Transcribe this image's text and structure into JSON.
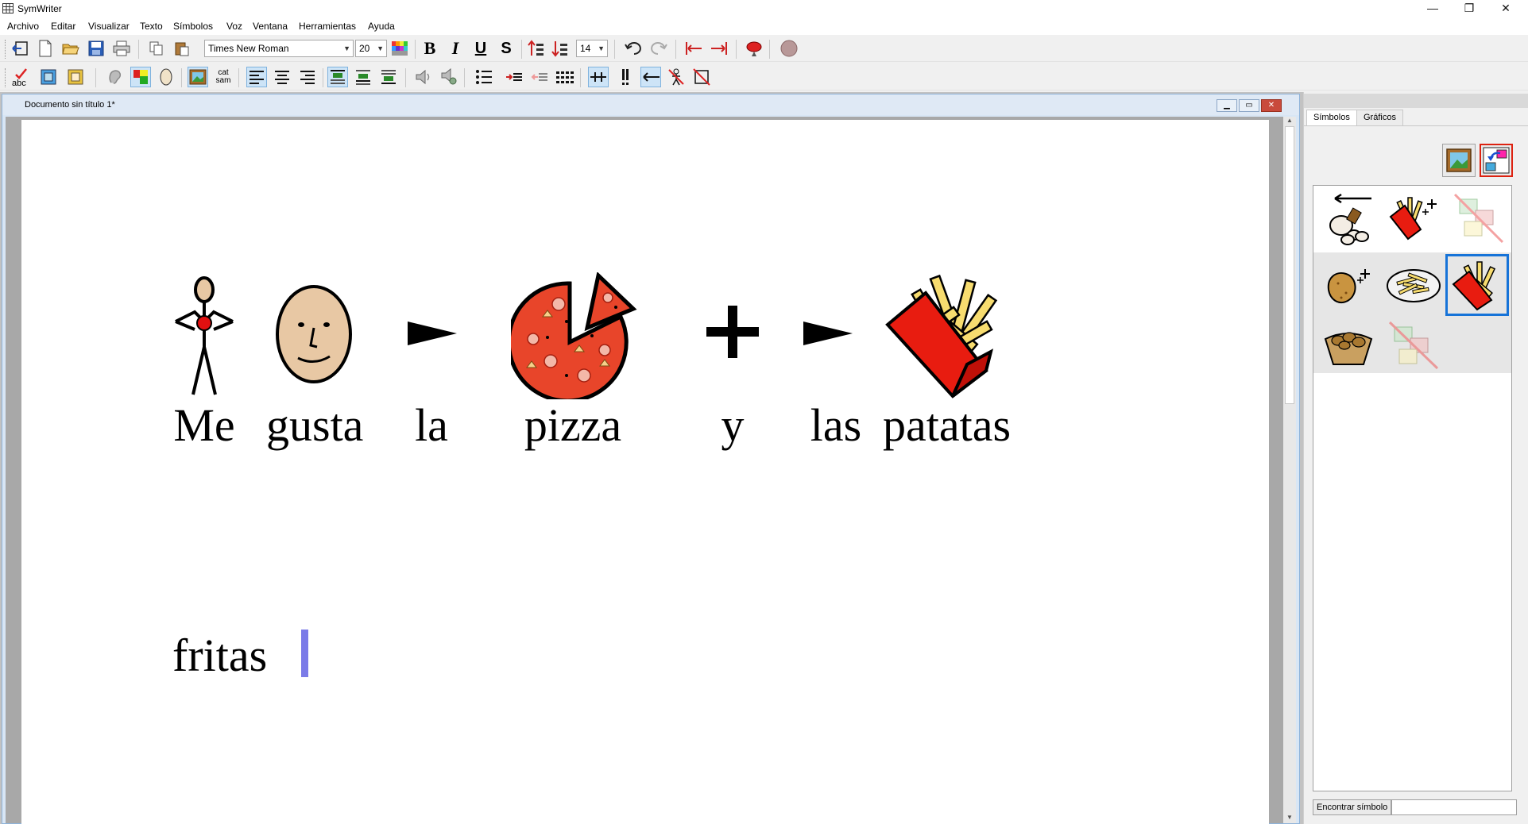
{
  "app": {
    "title": "SymWriter",
    "window_controls": {
      "minimize": "—",
      "restore": "❐",
      "close": "✕"
    }
  },
  "menu": [
    "Archivo",
    "Editar",
    "Visualizar",
    "Texto",
    "Símbolos",
    "Voz",
    "Ventana",
    "Herramientas",
    "Ayuda"
  ],
  "toolbar": {
    "font_name": "Times New Roman",
    "font_size": "20",
    "symbol_size": "14",
    "icons_row1": [
      "exit-icon",
      "new-document-icon",
      "open-folder-icon",
      "save-icon",
      "print-icon",
      "copy-icon",
      "paste-icon",
      "color-palette-icon",
      "bold-icon",
      "italic-icon",
      "underline-icon",
      "strikethrough-icon",
      "increase-line-spacing-icon",
      "decrease-line-spacing-icon",
      "undo-icon",
      "redo-icon",
      "indent-left-icon",
      "indent-right-icon",
      "record-icon",
      "voice-circle-icon"
    ],
    "icons_row2": [
      "spellcheck-icon",
      "text-box-blue-icon",
      "text-box-yellow-icon",
      "ear-icon",
      "color-blocks-icon",
      "oval-icon",
      "picture-frame-icon",
      "cat-sam-icon",
      "align-left-icon",
      "align-center-icon",
      "align-right-icon",
      "valign-top-icon",
      "valign-middle-icon",
      "valign-bottom-icon",
      "speaker-icon",
      "speaker-settings-icon",
      "bullet-list-icon",
      "indent-increase-icon",
      "indent-decrease-icon",
      "dotted-grid-icon",
      "symbol-spacing-icon",
      "exclamation-icon",
      "arrow-left-icon",
      "person-cross-icon",
      "no-symbol-icon"
    ],
    "labels": {
      "bold": "B",
      "italic": "I",
      "underline": "U",
      "strike": "S",
      "cat_sam_top": "cat",
      "cat_sam_bottom": "sam",
      "abc": "abc"
    }
  },
  "document": {
    "title": "Documento sin título 1*",
    "words_line1": [
      "Me",
      "gusta",
      "la",
      "pizza",
      "y",
      "las",
      "patatas"
    ],
    "words_line2": [
      "fritas"
    ],
    "colors": {
      "cursor": "#7b7be8",
      "pizza": "#e8452a",
      "fries_box": "#e81c10",
      "fries": "#f7dc6f"
    }
  },
  "panel": {
    "tabs": [
      "Símbolos",
      "Gráficos"
    ],
    "active_tab": "Símbolos",
    "find_button": "Encontrar símbolo",
    "find_value": "",
    "symbols": [
      [
        "potato-slices-icon",
        "fries-plus-icon",
        "no-symbol-crossed-icon"
      ],
      [
        "potato-plus-icon",
        "fries-plate-icon",
        "fries-box-icon"
      ],
      [
        "potato-basket-icon",
        "no-symbol-crossed-icon"
      ]
    ],
    "selected_symbol": "fries-box-icon"
  }
}
